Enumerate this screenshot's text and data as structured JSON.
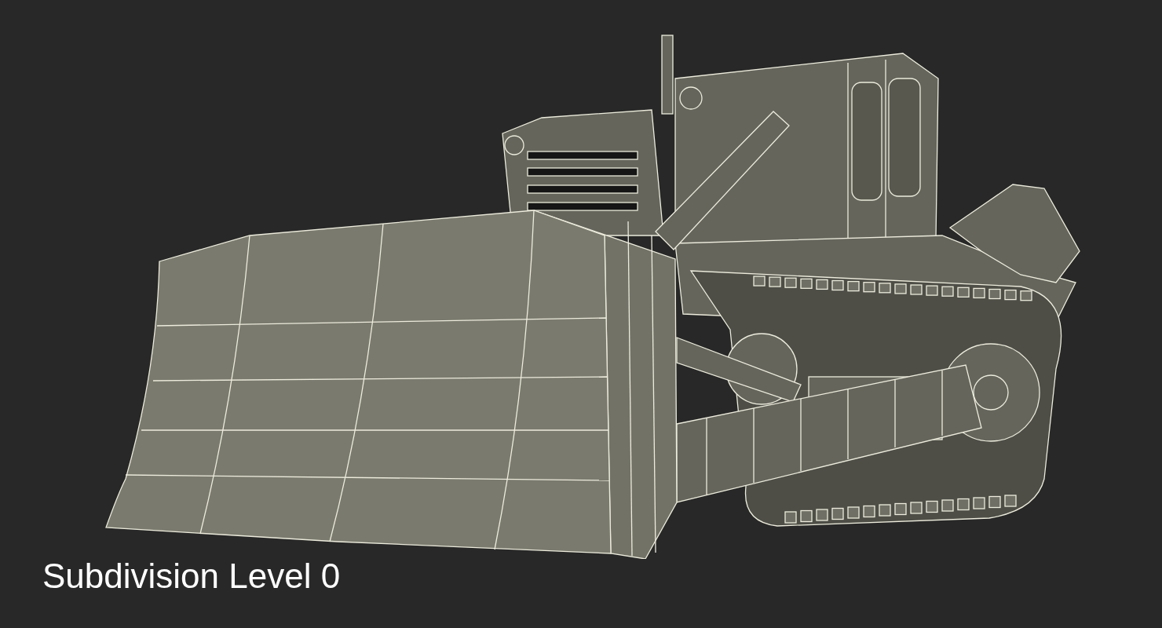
{
  "caption": {
    "text": "Subdivision Level 0"
  }
}
